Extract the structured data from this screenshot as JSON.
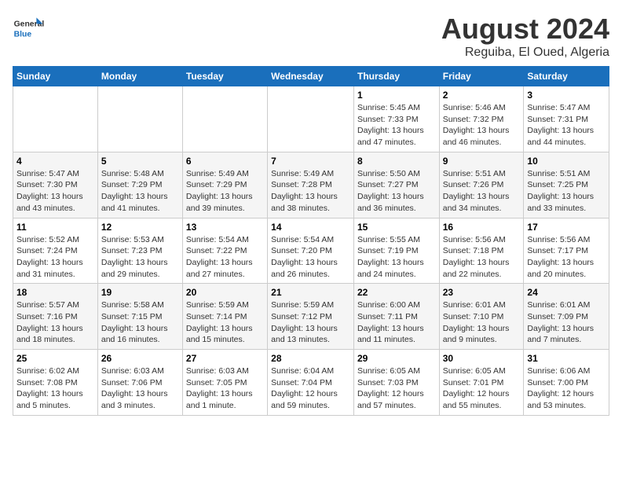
{
  "logo": {
    "general": "General",
    "blue": "Blue"
  },
  "title": "August 2024",
  "location": "Reguiba, El Oued, Algeria",
  "days_of_week": [
    "Sunday",
    "Monday",
    "Tuesday",
    "Wednesday",
    "Thursday",
    "Friday",
    "Saturday"
  ],
  "weeks": [
    [
      {
        "day": "",
        "info": ""
      },
      {
        "day": "",
        "info": ""
      },
      {
        "day": "",
        "info": ""
      },
      {
        "day": "",
        "info": ""
      },
      {
        "day": "1",
        "info": "Sunrise: 5:45 AM\nSunset: 7:33 PM\nDaylight: 13 hours and 47 minutes."
      },
      {
        "day": "2",
        "info": "Sunrise: 5:46 AM\nSunset: 7:32 PM\nDaylight: 13 hours and 46 minutes."
      },
      {
        "day": "3",
        "info": "Sunrise: 5:47 AM\nSunset: 7:31 PM\nDaylight: 13 hours and 44 minutes."
      }
    ],
    [
      {
        "day": "4",
        "info": "Sunrise: 5:47 AM\nSunset: 7:30 PM\nDaylight: 13 hours and 43 minutes."
      },
      {
        "day": "5",
        "info": "Sunrise: 5:48 AM\nSunset: 7:29 PM\nDaylight: 13 hours and 41 minutes."
      },
      {
        "day": "6",
        "info": "Sunrise: 5:49 AM\nSunset: 7:29 PM\nDaylight: 13 hours and 39 minutes."
      },
      {
        "day": "7",
        "info": "Sunrise: 5:49 AM\nSunset: 7:28 PM\nDaylight: 13 hours and 38 minutes."
      },
      {
        "day": "8",
        "info": "Sunrise: 5:50 AM\nSunset: 7:27 PM\nDaylight: 13 hours and 36 minutes."
      },
      {
        "day": "9",
        "info": "Sunrise: 5:51 AM\nSunset: 7:26 PM\nDaylight: 13 hours and 34 minutes."
      },
      {
        "day": "10",
        "info": "Sunrise: 5:51 AM\nSunset: 7:25 PM\nDaylight: 13 hours and 33 minutes."
      }
    ],
    [
      {
        "day": "11",
        "info": "Sunrise: 5:52 AM\nSunset: 7:24 PM\nDaylight: 13 hours and 31 minutes."
      },
      {
        "day": "12",
        "info": "Sunrise: 5:53 AM\nSunset: 7:23 PM\nDaylight: 13 hours and 29 minutes."
      },
      {
        "day": "13",
        "info": "Sunrise: 5:54 AM\nSunset: 7:22 PM\nDaylight: 13 hours and 27 minutes."
      },
      {
        "day": "14",
        "info": "Sunrise: 5:54 AM\nSunset: 7:20 PM\nDaylight: 13 hours and 26 minutes."
      },
      {
        "day": "15",
        "info": "Sunrise: 5:55 AM\nSunset: 7:19 PM\nDaylight: 13 hours and 24 minutes."
      },
      {
        "day": "16",
        "info": "Sunrise: 5:56 AM\nSunset: 7:18 PM\nDaylight: 13 hours and 22 minutes."
      },
      {
        "day": "17",
        "info": "Sunrise: 5:56 AM\nSunset: 7:17 PM\nDaylight: 13 hours and 20 minutes."
      }
    ],
    [
      {
        "day": "18",
        "info": "Sunrise: 5:57 AM\nSunset: 7:16 PM\nDaylight: 13 hours and 18 minutes."
      },
      {
        "day": "19",
        "info": "Sunrise: 5:58 AM\nSunset: 7:15 PM\nDaylight: 13 hours and 16 minutes."
      },
      {
        "day": "20",
        "info": "Sunrise: 5:59 AM\nSunset: 7:14 PM\nDaylight: 13 hours and 15 minutes."
      },
      {
        "day": "21",
        "info": "Sunrise: 5:59 AM\nSunset: 7:12 PM\nDaylight: 13 hours and 13 minutes."
      },
      {
        "day": "22",
        "info": "Sunrise: 6:00 AM\nSunset: 7:11 PM\nDaylight: 13 hours and 11 minutes."
      },
      {
        "day": "23",
        "info": "Sunrise: 6:01 AM\nSunset: 7:10 PM\nDaylight: 13 hours and 9 minutes."
      },
      {
        "day": "24",
        "info": "Sunrise: 6:01 AM\nSunset: 7:09 PM\nDaylight: 13 hours and 7 minutes."
      }
    ],
    [
      {
        "day": "25",
        "info": "Sunrise: 6:02 AM\nSunset: 7:08 PM\nDaylight: 13 hours and 5 minutes."
      },
      {
        "day": "26",
        "info": "Sunrise: 6:03 AM\nSunset: 7:06 PM\nDaylight: 13 hours and 3 minutes."
      },
      {
        "day": "27",
        "info": "Sunrise: 6:03 AM\nSunset: 7:05 PM\nDaylight: 13 hours and 1 minute."
      },
      {
        "day": "28",
        "info": "Sunrise: 6:04 AM\nSunset: 7:04 PM\nDaylight: 12 hours and 59 minutes."
      },
      {
        "day": "29",
        "info": "Sunrise: 6:05 AM\nSunset: 7:03 PM\nDaylight: 12 hours and 57 minutes."
      },
      {
        "day": "30",
        "info": "Sunrise: 6:05 AM\nSunset: 7:01 PM\nDaylight: 12 hours and 55 minutes."
      },
      {
        "day": "31",
        "info": "Sunrise: 6:06 AM\nSunset: 7:00 PM\nDaylight: 12 hours and 53 minutes."
      }
    ]
  ]
}
